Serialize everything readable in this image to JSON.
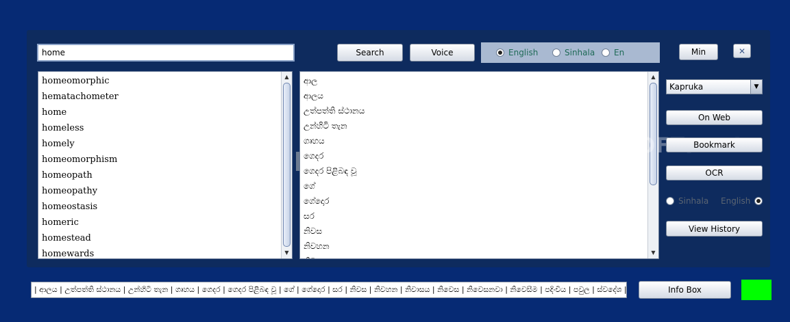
{
  "search": {
    "value": "home"
  },
  "buttons": {
    "search": "Search",
    "voice": "Voice",
    "min": "Min",
    "close": "✕",
    "on_web": "On Web",
    "bookmark": "Bookmark",
    "ocr": "OCR",
    "view_history": "View History",
    "info_box": "Info Box"
  },
  "language_radios": [
    {
      "label": "English",
      "selected": true
    },
    {
      "label": "Sinhala",
      "selected": false
    },
    {
      "label": "En",
      "selected": false
    }
  ],
  "ocr_radios": [
    {
      "label": "Sinhala",
      "selected": false
    },
    {
      "label": "English",
      "selected": true
    }
  ],
  "dropdown": {
    "selected": "Kapruka"
  },
  "suggestions": [
    "homeomorphic",
    "hematachometer",
    "home",
    "homeless",
    "homely",
    "homeomorphism",
    "homeopath",
    "homeopathy",
    "homeostasis",
    "homeric",
    "homestead",
    "homewards"
  ],
  "translations": [
    "ආල",
    "ආලය",
    "උත්පත්ති ස්ථානය",
    "උන්හිටි තැන",
    "ගෘහය",
    "ගෙදර",
    "ගෙදර පිළිබඳ වූ",
    "ගේ",
    "ගේදොර",
    "සර",
    "නිවස",
    "නිවහන",
    "නිව"
  ],
  "status_text": "| ආලය | උත්පත්ති ස්ථානය | උන්හිටි තැන | ගෘහය | ගෙදර | ගෙදර පිළිබඳ වූ | ගේ | ගේදොර | සර | නිවස | නිවහන | නිවාසය | නිවෙස | නිවෙසනවා | නිවෙසීම | පදිංචිය | පවුල | ස්වදේශ | සියරට",
  "watermark": "SOFTPEDIA",
  "colors": {
    "background": "#062a74",
    "panel": "#0e2b5e",
    "indicator": "#00ff00",
    "radio_text": "#1e6a56"
  }
}
